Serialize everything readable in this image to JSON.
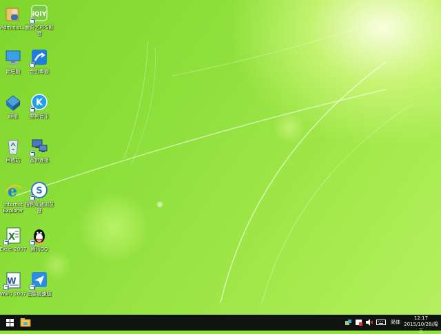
{
  "desktop": {
    "icons": [
      {
        "label": "Administ...",
        "icon": "user-folder-icon"
      },
      {
        "label": "爱奇艺PPS影音",
        "icon": "iqiyi-pps-icon"
      },
      {
        "label": "此电脑",
        "icon": "computer-icon"
      },
      {
        "label": "金山毒霸",
        "icon": "kingsoft-duba-icon"
      },
      {
        "label": "网络",
        "icon": "network-icon"
      },
      {
        "label": "酷狗音乐",
        "icon": "kugou-music-icon"
      },
      {
        "label": "回收站",
        "icon": "recycle-bin-icon"
      },
      {
        "label": "宽带连接",
        "icon": "broadband-connection-icon"
      },
      {
        "label": "Internet Explorer",
        "icon": "internet-explorer-icon"
      },
      {
        "label": "搜狗高速浏览器",
        "icon": "sogou-browser-icon"
      },
      {
        "label": "Excel 2007",
        "icon": "excel-icon"
      },
      {
        "label": "腾讯QQ",
        "icon": "qq-penguin-icon"
      },
      {
        "label": "Word 2007",
        "icon": "word-icon"
      },
      {
        "label": "迅雷极速版",
        "icon": "xunlei-icon"
      }
    ]
  },
  "taskbar": {
    "pinned": [
      "windows-start-icon",
      "file-explorer-icon"
    ],
    "tray": {
      "icons": [
        "network-tray-icon",
        "security-tray-icon",
        "volume-icon",
        "keyboard-icon"
      ],
      "ime_label": "简体",
      "time": "12:17",
      "date": "2015/10/28/周三"
    }
  },
  "colors": {
    "wallpaper_green": "#8ee23a",
    "taskbar": "#101410"
  }
}
